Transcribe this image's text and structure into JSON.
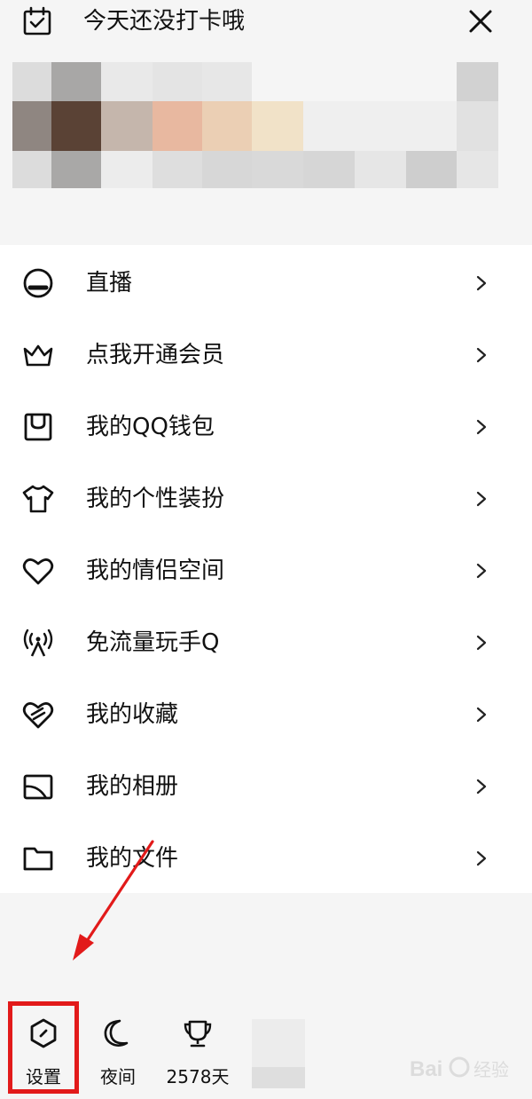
{
  "header": {
    "checkin_text": "今天还没打卡哦"
  },
  "menu": {
    "items": [
      {
        "label": "直播",
        "icon": "live-icon"
      },
      {
        "label": "点我开通会员",
        "icon": "crown-icon"
      },
      {
        "label": "我的QQ钱包",
        "icon": "wallet-icon"
      },
      {
        "label": "我的个性装扮",
        "icon": "shirt-icon"
      },
      {
        "label": "我的情侣空间",
        "icon": "heart-icon"
      },
      {
        "label": "免流量玩手Q",
        "icon": "signal-tower-icon"
      },
      {
        "label": "我的收藏",
        "icon": "favorite-icon"
      },
      {
        "label": "我的相册",
        "icon": "album-icon"
      },
      {
        "label": "我的文件",
        "icon": "folder-icon"
      }
    ]
  },
  "bottom_bar": {
    "settings_label": "设置",
    "night_label": "夜间",
    "days_label": "2578天"
  },
  "annotation": {
    "highlight_color": "#e21a1a"
  },
  "watermark": {
    "text": "Bai 经验"
  }
}
